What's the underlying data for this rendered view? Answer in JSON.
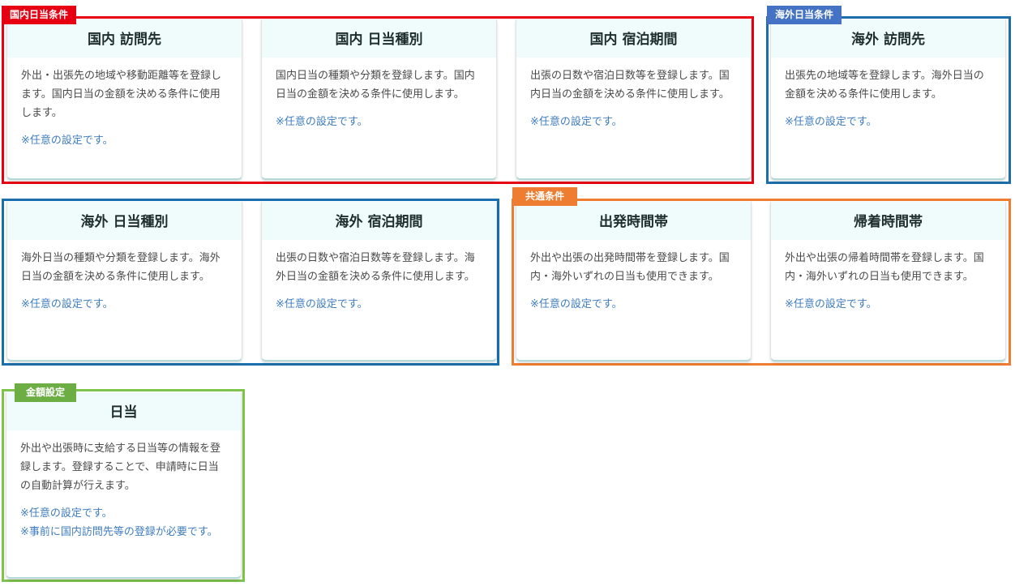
{
  "groups": {
    "domestic": "国内日当条件",
    "overseas": "海外日当条件",
    "common": "共通条件",
    "amount": "金額設定"
  },
  "cards": {
    "domestic_destination": {
      "title": "国内 訪問先",
      "desc": "外出・出張先の地域や移動距離等を登録します。国内日当の金額を決める条件に使用します。",
      "note": "※任意の設定です。"
    },
    "domestic_type": {
      "title": "国内 日当種別",
      "desc": "国内日当の種類や分類を登録します。国内日当の金額を決める条件に使用します。",
      "note": "※任意の設定です。"
    },
    "domestic_stay": {
      "title": "国内 宿泊期間",
      "desc": "出張の日数や宿泊日数等を登録します。国内日当の金額を決める条件に使用します。",
      "note": "※任意の設定です。"
    },
    "overseas_destination": {
      "title": "海外 訪問先",
      "desc": "出張先の地域等を登録します。海外日当の金額を決める条件に使用します。",
      "note": "※任意の設定です。"
    },
    "overseas_type": {
      "title": "海外 日当種別",
      "desc": "海外日当の種類や分類を登録します。海外日当の金額を決める条件に使用します。",
      "note": "※任意の設定です。"
    },
    "overseas_stay": {
      "title": "海外 宿泊期間",
      "desc": "出張の日数や宿泊日数等を登録します。海外日当の金額を決める条件に使用します。",
      "note": "※任意の設定です。"
    },
    "departure_time": {
      "title": "出発時間帯",
      "desc": "外出や出張の出発時間帯を登録します。国内・海外いずれの日当も使用できます。",
      "note": "※任意の設定です。"
    },
    "return_time": {
      "title": "帰着時間帯",
      "desc": "外出や出張の帰着時間帯を登録します。国内・海外いずれの日当も使用できます。",
      "note": "※任意の設定です。"
    },
    "daily_allowance": {
      "title": "日当",
      "desc": "外出や出張時に支給する日当等の情報を登録します。登録することで、申請時に日当の自動計算が行えます。",
      "note": "※任意の設定です。",
      "note2": "※事前に国内訪問先等の登録が必要です。"
    }
  }
}
